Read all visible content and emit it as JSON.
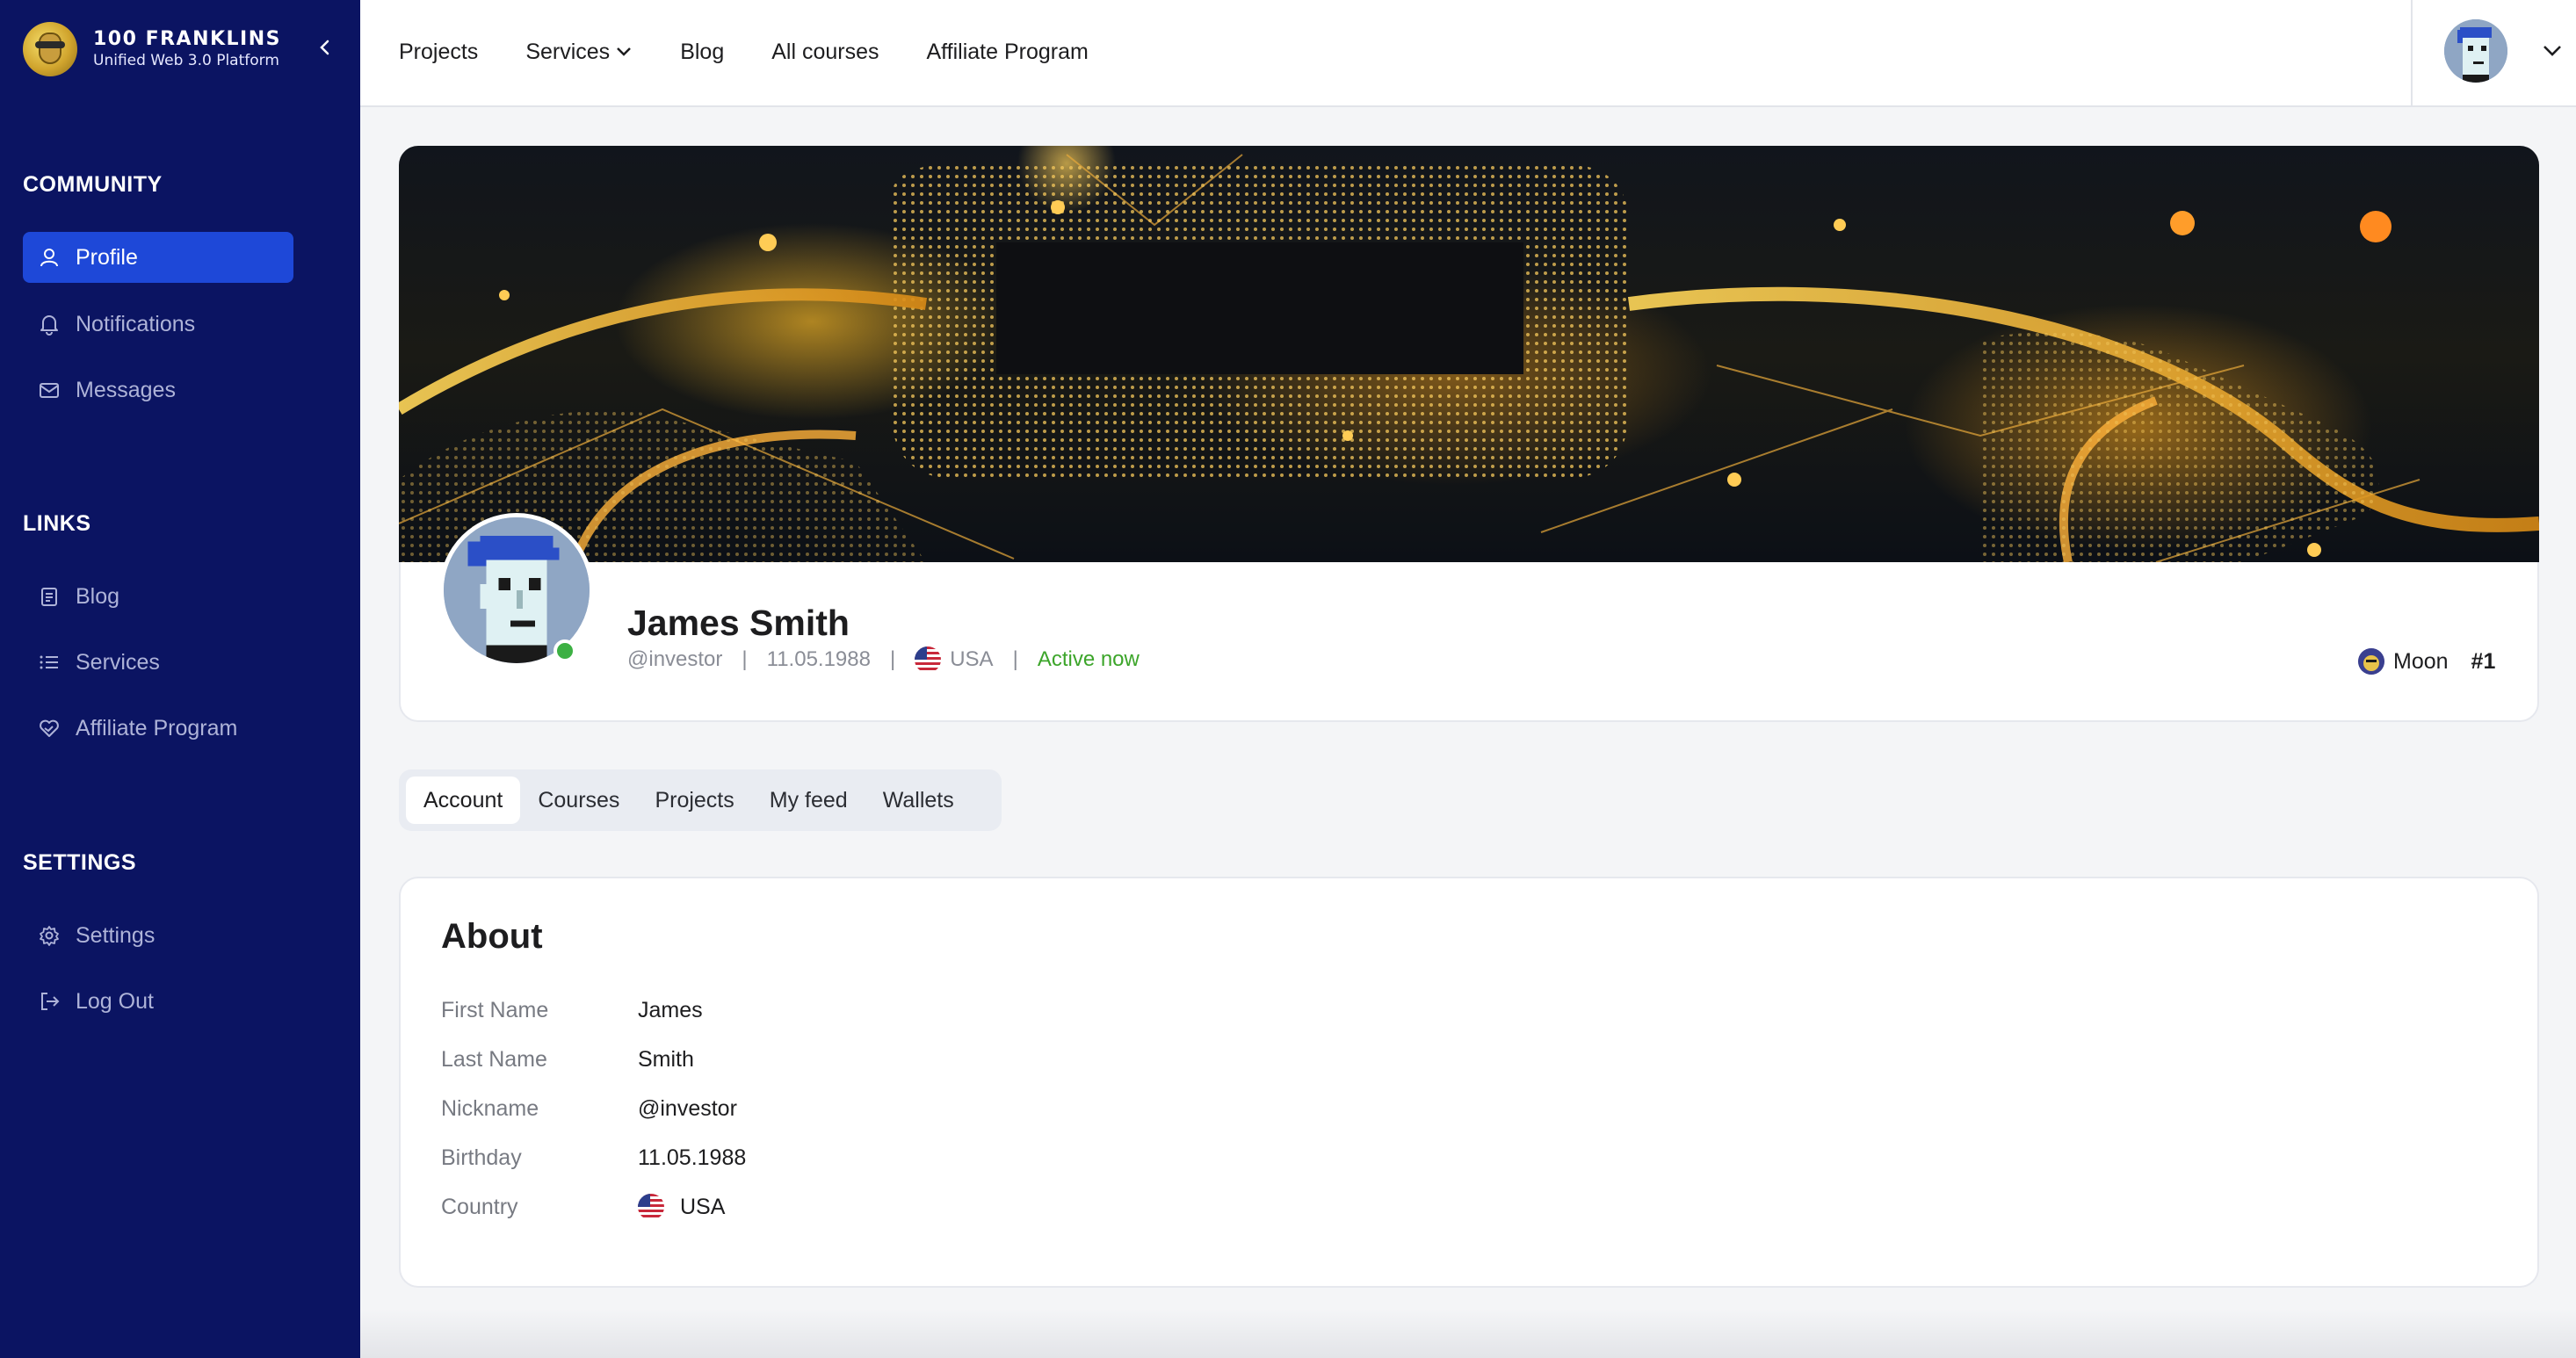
{
  "brand": {
    "name": "100 FRANKLINS",
    "subtitle": "Unified Web 3.0 Platform"
  },
  "sidebar": {
    "sections": [
      {
        "title": "COMMUNITY",
        "items": [
          {
            "label": "Profile",
            "icon": "user-icon",
            "active": true
          },
          {
            "label": "Notifications",
            "icon": "bell-icon"
          },
          {
            "label": "Messages",
            "icon": "mail-icon"
          }
        ]
      },
      {
        "title": "LINKS",
        "items": [
          {
            "label": "Blog",
            "icon": "clipboard-icon"
          },
          {
            "label": "Services",
            "icon": "list-icon"
          },
          {
            "label": "Affiliate Program",
            "icon": "handshake-heart-icon"
          }
        ]
      },
      {
        "title": "SETTINGS",
        "items": [
          {
            "label": "Settings",
            "icon": "gear-icon"
          },
          {
            "label": "Log Out",
            "icon": "logout-icon"
          }
        ]
      }
    ]
  },
  "topnav": {
    "items": [
      "Projects",
      "Services",
      "Blog",
      "All courses",
      "Affiliate Program"
    ]
  },
  "profile": {
    "name": "James Smith",
    "nickname": "@investor",
    "birthday": "11.05.1988",
    "country": "USA",
    "status": "Active now",
    "rank_label": "Moon",
    "rank_number": "#1"
  },
  "tabs": [
    "Account",
    "Courses",
    "Projects",
    "My feed",
    "Wallets"
  ],
  "about": {
    "title": "About",
    "rows": [
      {
        "label": "First Name",
        "value": "James"
      },
      {
        "label": "Last Name",
        "value": "Smith"
      },
      {
        "label": "Nickname",
        "value": "@investor"
      },
      {
        "label": "Birthday",
        "value": "11.05.1988"
      },
      {
        "label": "Country",
        "value": "USA"
      }
    ]
  },
  "colors": {
    "sidebar_bg": "#0b1462",
    "accent": "#1e48d8",
    "active_status": "#3ca52a",
    "online_dot": "#3cb043"
  }
}
